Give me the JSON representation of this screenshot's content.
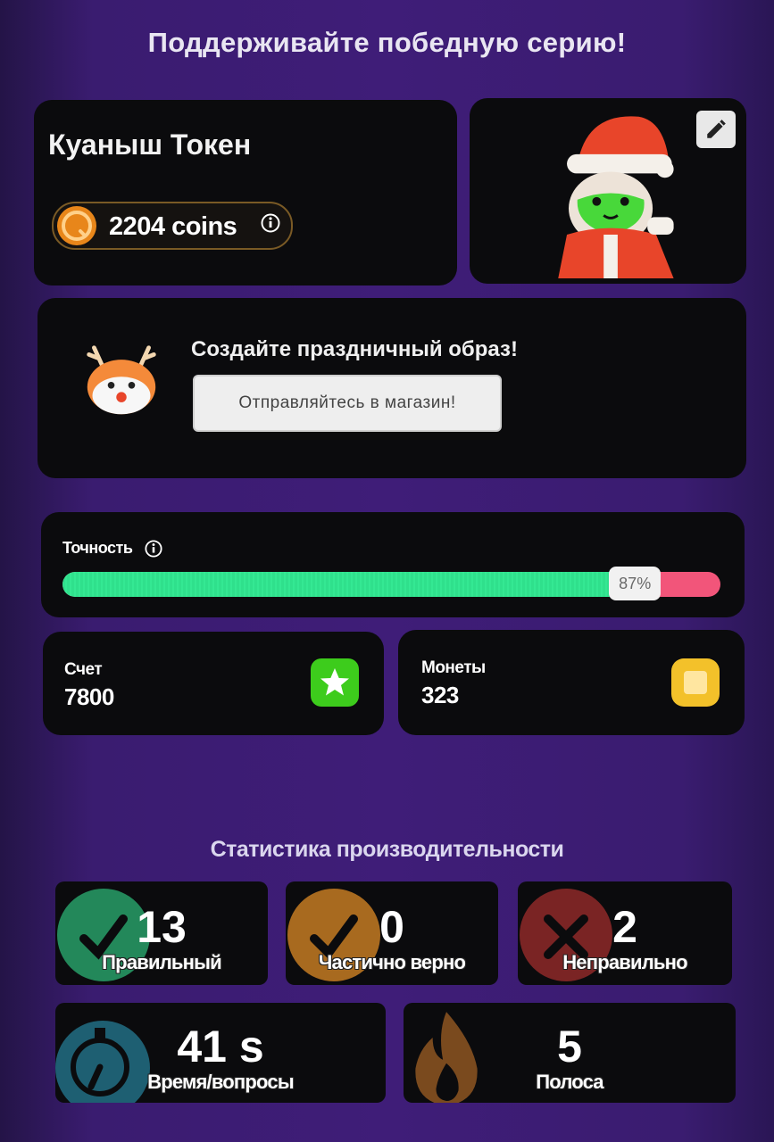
{
  "headline": "Поддерживайте победную серию!",
  "profile": {
    "name": "Куаныш Токен",
    "coins_label": "2204 coins"
  },
  "promo": {
    "title": "Создайте праздничный образ!",
    "button_label": "Отправляйтесь в магазин!"
  },
  "accuracy": {
    "label": "Точность",
    "value": 0.87,
    "badge": "87%"
  },
  "stats": {
    "score_label": "Счет",
    "score_value": "7800",
    "coins_label": "Монеты",
    "coins_value": "323"
  },
  "performance": {
    "title": "Статистика производительности",
    "correct": {
      "value": "13",
      "label": "Правильный"
    },
    "partial": {
      "value": "0",
      "label": "Частично верно"
    },
    "wrong": {
      "value": "2",
      "label": "Неправильно"
    },
    "time": {
      "value": "41 s",
      "label": "Время/вопросы"
    },
    "streak": {
      "value": "5",
      "label": "Полоса"
    }
  },
  "colors": {
    "correct": "#23885a",
    "partial": "#a86a1f",
    "wrong": "#7a2424",
    "time": "#1e5f72",
    "streak": "#7a4a1e",
    "score_badge": "#3dcc1c",
    "coins_badge": "#f3c12a"
  },
  "icons": [
    "coin-icon",
    "info-icon",
    "pencil-icon",
    "santa-avatar",
    "reindeer-icon",
    "star-icon",
    "coin-square-icon",
    "checkmark-icon",
    "cross-icon",
    "stopwatch-icon",
    "flame-icon"
  ]
}
